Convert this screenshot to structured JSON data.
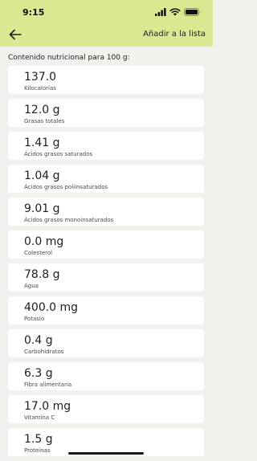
{
  "status_bar": {
    "time": "9:15"
  },
  "header": {
    "back_icon": "arrow-left-icon",
    "action_label": "Añadir a la lista"
  },
  "section_title": "Contenido nutricional para 100 g:",
  "nutrients": [
    {
      "value": "137.0",
      "label": "Kilocalorías"
    },
    {
      "value": "12.0 g",
      "label": "Grasas totales"
    },
    {
      "value": "1.41 g",
      "label": "Ácidos grasos saturados"
    },
    {
      "value": "1.04 g",
      "label": "Ácidos grasos poliinsaturados"
    },
    {
      "value": "9.01 g",
      "label": "Ácidos grasos monoinsaturados"
    },
    {
      "value": "0.0 mg",
      "label": "Colesterol"
    },
    {
      "value": "78.8 g",
      "label": "Agua"
    },
    {
      "value": "400.0 mg",
      "label": "Potasio"
    },
    {
      "value": "0.4 g",
      "label": "Carbohidratos"
    },
    {
      "value": "6.3 g",
      "label": "Fibra alimentaria"
    },
    {
      "value": "17.0 mg",
      "label": "Vitamina C"
    },
    {
      "value": "1.5 g",
      "label": "Proteínas"
    }
  ],
  "colors": {
    "header_bg": "#dbe891",
    "page_bg": "#f1f2ee",
    "card_bg": "#ffffff"
  }
}
